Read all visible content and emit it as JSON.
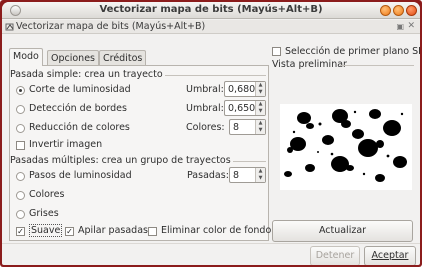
{
  "window": {
    "title": "Vectorizar mapa de bits (Mayús+Alt+B)",
    "subtitle": "Vectorizar mapa de bits (Mayús+Alt+B)"
  },
  "tabs": [
    {
      "label": "Modo"
    },
    {
      "label": "Opciones"
    },
    {
      "label": "Créditos"
    }
  ],
  "single_scan": {
    "title": "Pasada simple: crea un trayecto",
    "brightness_label": "Corte de luminosidad",
    "brightness_param": "Umbral:",
    "brightness_value": "0,680",
    "edge_label": "Detección de bordes",
    "edge_param": "Umbral:",
    "edge_value": "0,650",
    "color_label": "Reducción de colores",
    "color_param": "Colores:",
    "color_value": "8",
    "invert_label": "Invertir imagen"
  },
  "multi_scan": {
    "title": "Pasadas múltiples: crea un grupo de trayectos",
    "steps_label": "Pasos de luminosidad",
    "steps_param": "Pasadas:",
    "steps_value": "8",
    "colors_label": "Colores",
    "grays_label": "Grises",
    "smooth_label": "Suave",
    "stack_label": "Apilar pasadas",
    "remove_bg_label": "Eliminar color de fondo"
  },
  "siox_label": "Selección de primer plano SIOX",
  "preview_label": "Vista preliminar",
  "buttons": {
    "update": "Actualizar",
    "stop": "Detener",
    "accept": "Aceptar"
  },
  "colors": {
    "accent": "#e86a1a",
    "frame": "#8b1c1c"
  }
}
